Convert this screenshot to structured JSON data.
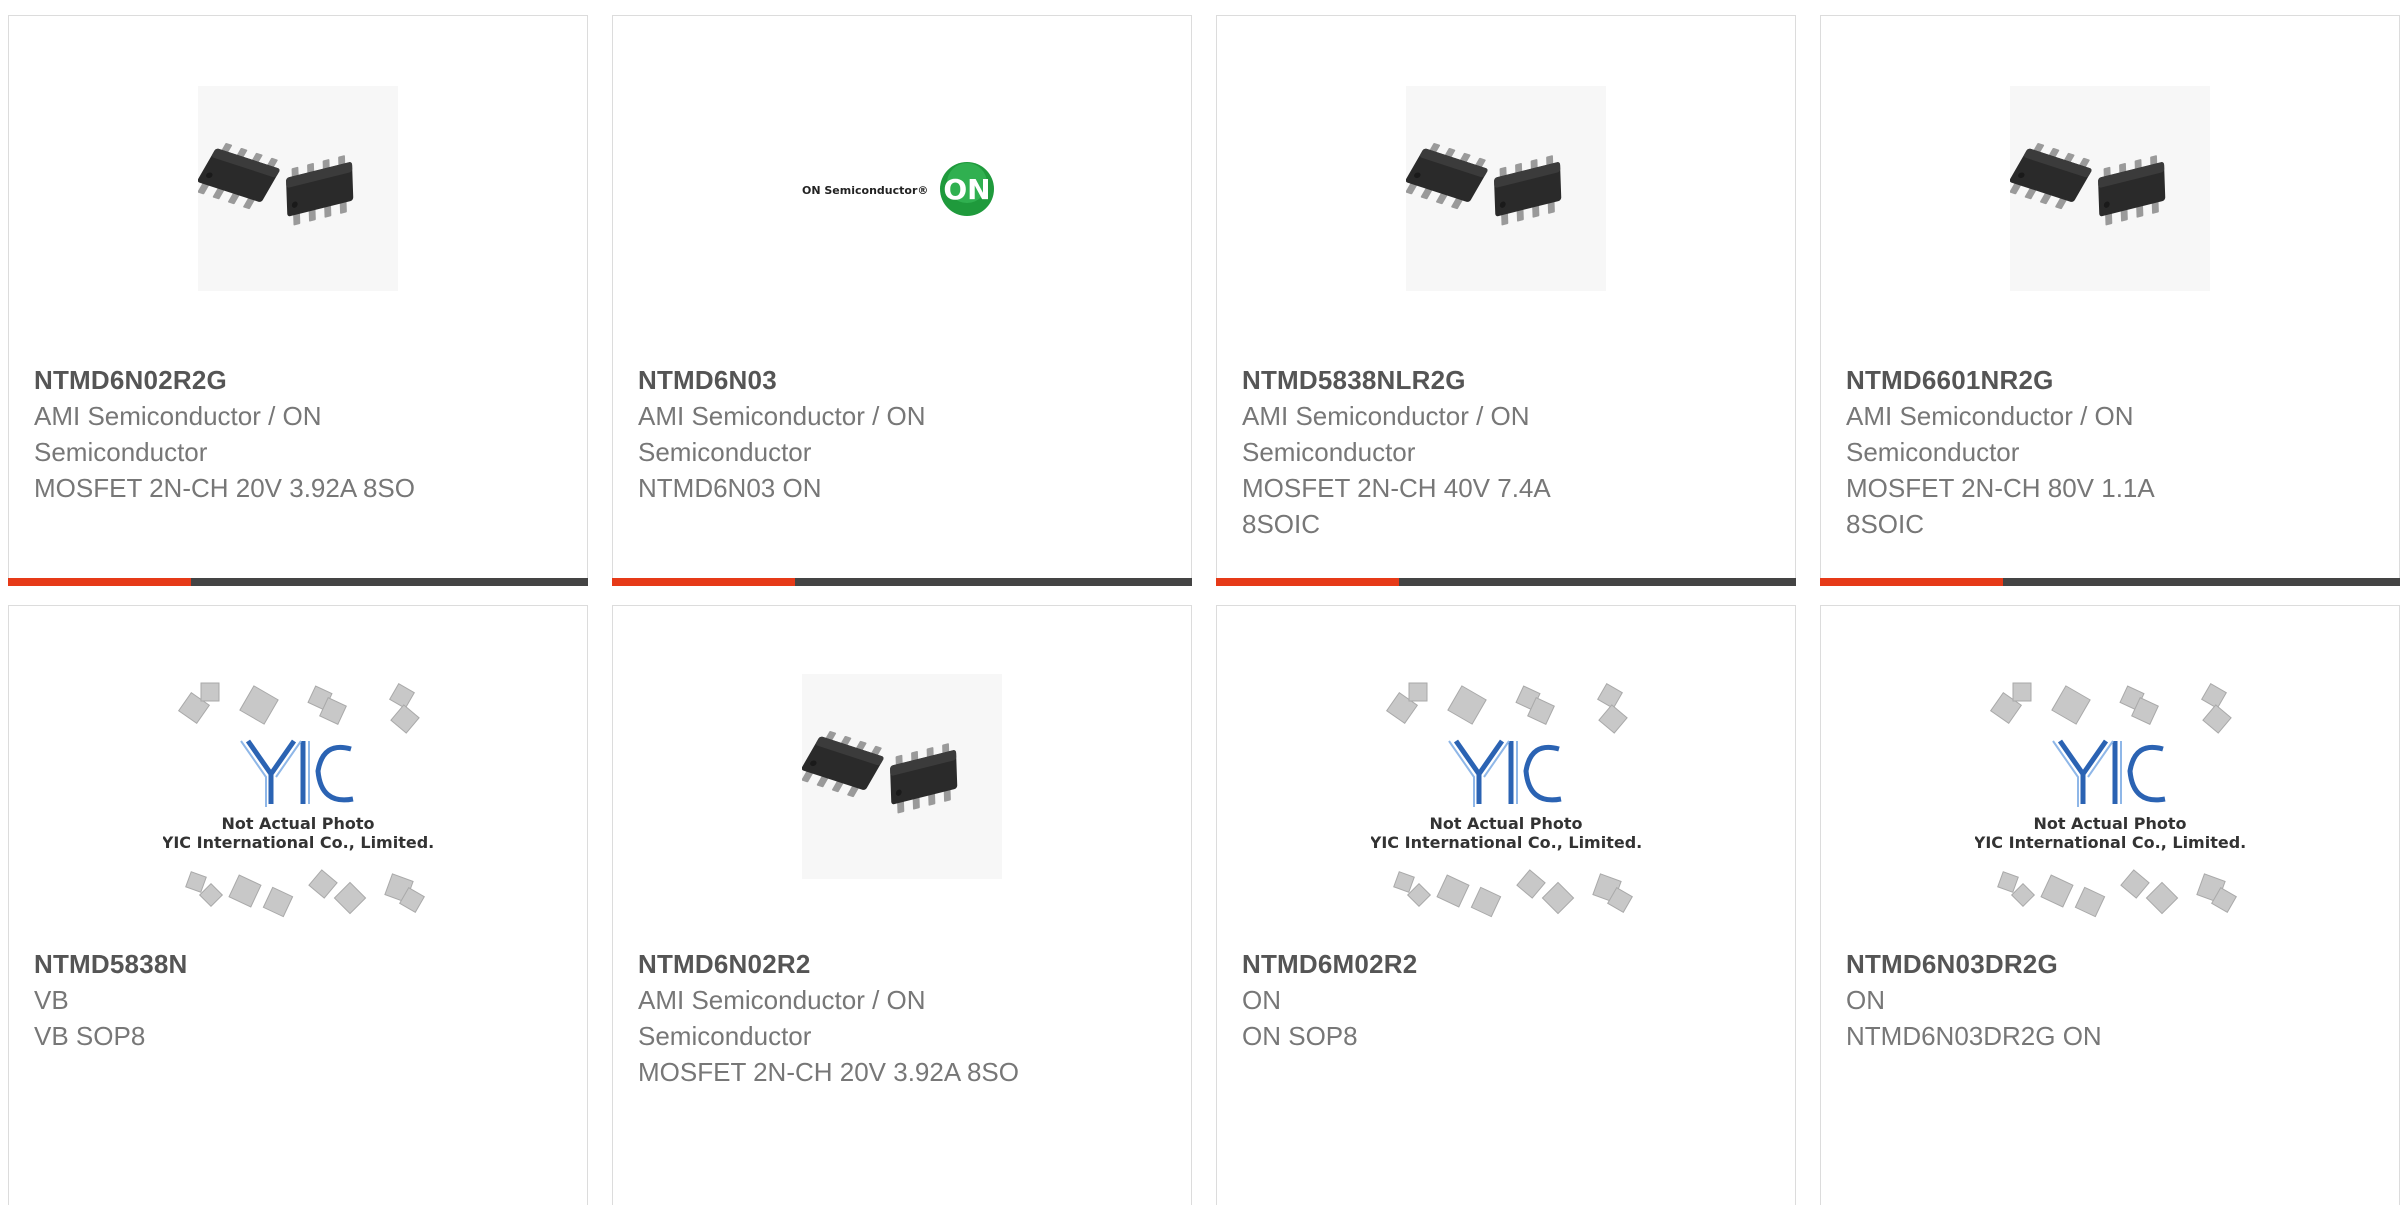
{
  "products": [
    {
      "part": "NTMD6N02R2G",
      "maker_lines": [
        "AMI Semiconductor / ON",
        "Semiconductor"
      ],
      "desc_lines": [
        "MOSFET 2N-CH 20V 3.92A 8SO"
      ],
      "image": "chip-photo"
    },
    {
      "part": "NTMD6N03",
      "maker_lines": [
        "AMI Semiconductor / ON",
        "Semiconductor"
      ],
      "desc_lines": [
        "NTMD6N03 ON"
      ],
      "image": "on-semiconductor-logo",
      "logo_text": "ON Semiconductor®",
      "logo_badge": "ON"
    },
    {
      "part": "NTMD5838NLR2G",
      "maker_lines": [
        "AMI Semiconductor / ON",
        "Semiconductor"
      ],
      "desc_lines": [
        "MOSFET 2N-CH 40V 7.4A",
        "8SOIC"
      ],
      "image": "chip-photo"
    },
    {
      "part": "NTMD6601NR2G",
      "maker_lines": [
        "AMI Semiconductor / ON",
        "Semiconductor"
      ],
      "desc_lines": [
        "MOSFET 2N-CH 80V 1.1A",
        "8SOIC"
      ],
      "image": "chip-photo"
    },
    {
      "part": "NTMD5838N",
      "maker_lines": [
        "VB"
      ],
      "desc_lines": [
        "VB SOP8"
      ],
      "image": "placeholder-photo",
      "placeholder_logo": "YIC",
      "placeholder_line1": "Not Actual Photo",
      "placeholder_line2": "YIC International Co., Limited."
    },
    {
      "part": "NTMD6N02R2",
      "maker_lines": [
        "AMI Semiconductor / ON",
        "Semiconductor"
      ],
      "desc_lines": [
        "MOSFET 2N-CH 20V 3.92A 8SO"
      ],
      "image": "chip-photo"
    },
    {
      "part": "NTMD6M02R2",
      "maker_lines": [
        "ON"
      ],
      "desc_lines": [
        "ON SOP8"
      ],
      "image": "placeholder-photo",
      "placeholder_logo": "YIC",
      "placeholder_line1": "Not Actual Photo",
      "placeholder_line2": "YIC International Co., Limited."
    },
    {
      "part": "NTMD6N03DR2G",
      "maker_lines": [
        "ON"
      ],
      "desc_lines": [
        "NTMD6N03DR2G ON"
      ],
      "image": "placeholder-photo",
      "placeholder_logo": "YIC",
      "placeholder_line1": "Not Actual Photo",
      "placeholder_line2": "YIC International Co., Limited."
    }
  ],
  "colors": {
    "accent_red": "#e63a18",
    "accent_dark": "#444444",
    "on_green": "#1f9a3c"
  }
}
